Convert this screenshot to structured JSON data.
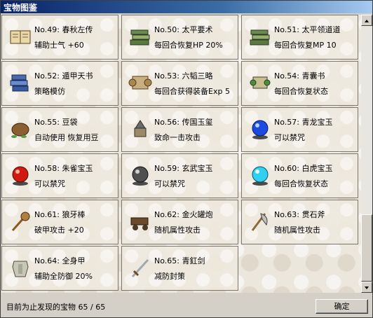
{
  "window": {
    "title": "宝物图鉴"
  },
  "items": [
    {
      "name": "No.49: 春秋左传",
      "desc": "辅助士气 +60",
      "icon": "book-icon"
    },
    {
      "name": "No.50: 太平要术",
      "desc": "每回合恢复HP 20%",
      "icon": "books-stack-icon"
    },
    {
      "name": "No.51: 太平领道道",
      "desc": "每回合恢复MP 10",
      "icon": "books-stack-icon"
    },
    {
      "name": "No.52: 遁甲天书",
      "desc": "策略模仿",
      "icon": "blue-books-icon"
    },
    {
      "name": "No.53: 六韬三略",
      "desc": "每回合获得装备Exp 5",
      "icon": "scroll-icon"
    },
    {
      "name": "No.54: 青囊书",
      "desc": "每回合恢复状态",
      "icon": "green-scroll-icon"
    },
    {
      "name": "No.55: 豆袋",
      "desc": "自动使用 恢复用豆",
      "icon": "bean-bag-icon"
    },
    {
      "name": "No.56: 传国玉玺",
      "desc": "致命一击攻击",
      "icon": "seal-icon"
    },
    {
      "name": "No.57: 青龙宝玉",
      "desc": "可以禁咒",
      "icon": "blue-orb-icon"
    },
    {
      "name": "No.58: 朱雀宝玉",
      "desc": "可以禁咒",
      "icon": "red-orb-icon"
    },
    {
      "name": "No.59: 玄武宝玉",
      "desc": "可以禁咒",
      "icon": "black-orb-icon"
    },
    {
      "name": "No.60: 白虎宝玉",
      "desc": "每回合恢复状态",
      "icon": "cyan-orb-icon"
    },
    {
      "name": "No.61: 狼牙棒",
      "desc": "破甲攻击 +20",
      "icon": "mace-icon"
    },
    {
      "name": "No.62: 金火罐炮",
      "desc": "随机属性攻击",
      "icon": "cannon-icon"
    },
    {
      "name": "No.63: 贯石斧",
      "desc": "随机属性攻击",
      "icon": "axe-icon"
    },
    {
      "name": "No.64: 全身甲",
      "desc": "辅助全防御 20%",
      "icon": "armor-icon"
    },
    {
      "name": "No.65: 青釭剑",
      "desc": "减防封策",
      "icon": "sword-icon"
    }
  ],
  "footer": {
    "status_text": "目前为止发现的宝物 65 / 65",
    "ok_label": "确定"
  }
}
